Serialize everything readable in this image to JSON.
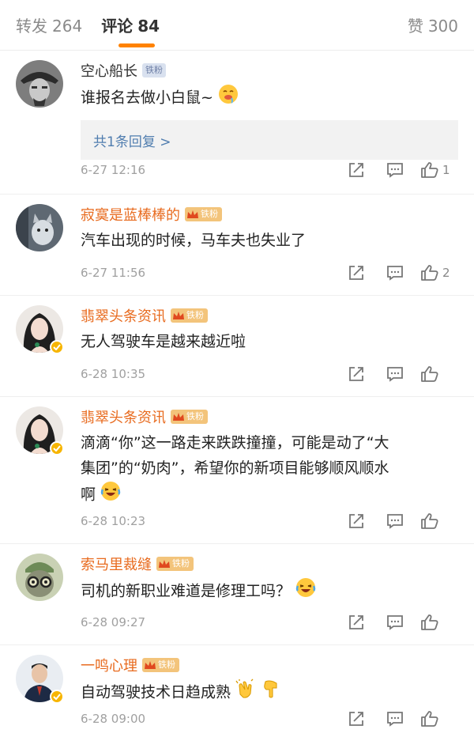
{
  "tabs": {
    "repost_label": "转发",
    "repost_count": "264",
    "comment_label": "评论",
    "comment_count": "84",
    "like_label": "赞",
    "like_count": "300"
  },
  "comments": [
    {
      "name": "空心船长",
      "fan_badge": "铁粉",
      "text": "谁报名去做小白鼠~",
      "emoji": "drooling-face",
      "reply_summary": "共1条回复 >",
      "time": "6-27 12:16",
      "likes": "1"
    },
    {
      "name": "寂寞是蓝棒棒的",
      "fan_badge": "铁粉",
      "text": "汽车出现的时候，马车夫也失业了",
      "time": "6-27 11:56",
      "likes": "2"
    },
    {
      "name": "翡翠头条资讯",
      "fan_badge": "铁粉",
      "text": "无人驾驶车是越来越近啦",
      "time": "6-28 10:35",
      "likes": ""
    },
    {
      "name": "翡翠头条资讯",
      "fan_badge": "铁粉",
      "text_line1": "滴滴“你”这一路走来跌跌撞撞，可能是动了“大",
      "text_line2": "集团”的“奶肉”，希望你的新项目能够顺风顺水",
      "text_line3": "啊",
      "emoji": "laughing-tears",
      "time": "6-28 10:23",
      "likes": ""
    },
    {
      "name": "索马里裁缝",
      "fan_badge": "铁粉",
      "text": "司机的新职业难道是修理工吗？",
      "emoji": "laughing-tears",
      "time": "6-28 09:27",
      "likes": ""
    },
    {
      "name": "一鸣心理",
      "fan_badge": "铁粉",
      "text": "自动驾驶技术日趋成熟",
      "emoji": "clapping-hands",
      "emoji2": "pointing-down",
      "time": "6-28 09:00",
      "likes": ""
    }
  ],
  "colors": {
    "accent": "#ff8200",
    "link": "#507daf",
    "name_orange": "#e86b1f",
    "verified": "#f7b500"
  }
}
